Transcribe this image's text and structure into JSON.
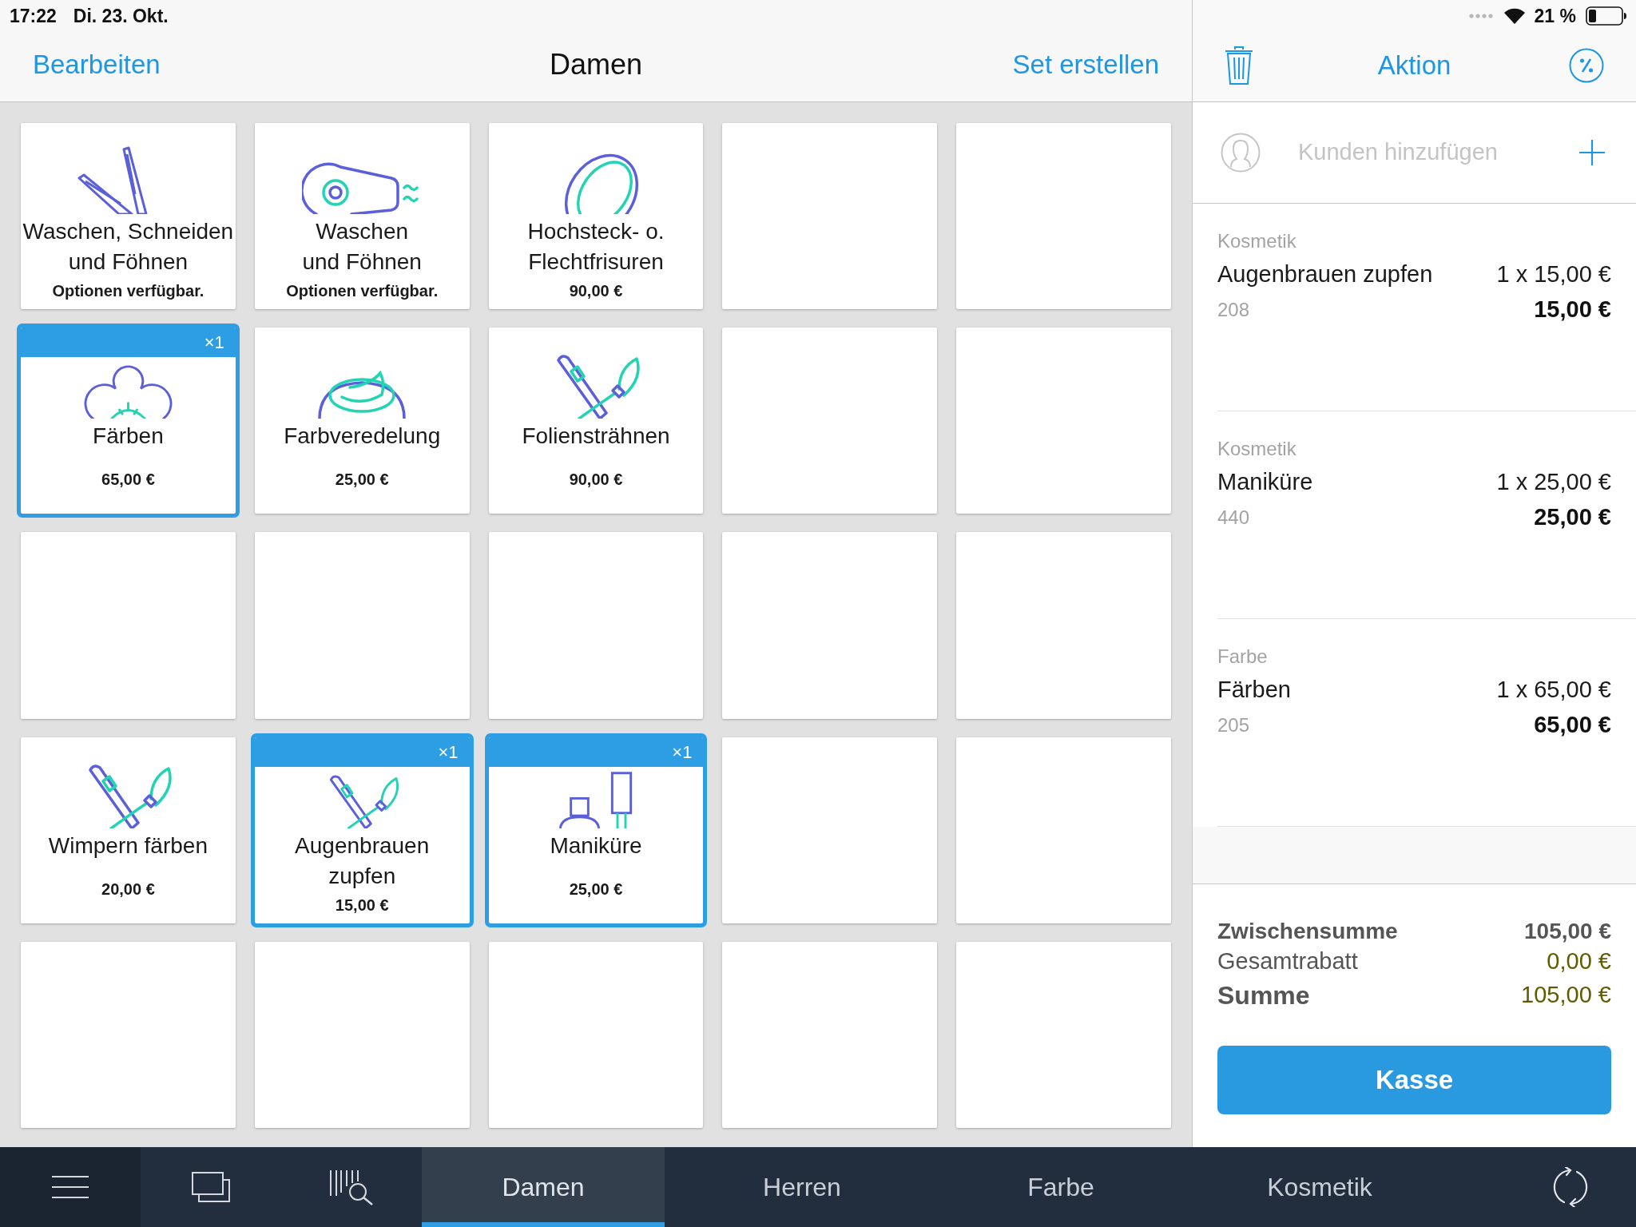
{
  "status_bar": {
    "time": "17:22",
    "date": "Di. 23. Okt.",
    "battery": "21 %"
  },
  "nav_bar": {
    "left_button": "Bearbeiten",
    "title": "Damen",
    "right_button": "Set erstellen"
  },
  "tiles": [
    {
      "kind": "service",
      "name": "Waschen, Schneiden\nund Föhnen",
      "note": "Optionen verfügbar.",
      "selected": false
    },
    {
      "kind": "service",
      "name": "Waschen\nund Föhnen",
      "note": "Optionen verfügbar.",
      "selected": false
    },
    {
      "kind": "service",
      "name": "Hochsteck- o.\nFlechtfrisuren",
      "price": "90,00 €",
      "selected": false
    },
    {
      "kind": "empty",
      "selected": false
    },
    {
      "kind": "empty",
      "selected": false
    },
    {
      "kind": "service",
      "name": "Färben",
      "price": "65,00 €",
      "selected": true,
      "badge": "×1"
    },
    {
      "kind": "service",
      "name": "Farbveredelung",
      "price": "25,00 €",
      "selected": false
    },
    {
      "kind": "service",
      "name": "Foliensträhnen",
      "price": "90,00 €",
      "selected": false
    },
    {
      "kind": "empty",
      "selected": false
    },
    {
      "kind": "empty",
      "selected": false
    },
    {
      "kind": "empty",
      "selected": false
    },
    {
      "kind": "empty",
      "selected": false
    },
    {
      "kind": "empty",
      "selected": false
    },
    {
      "kind": "empty",
      "selected": false
    },
    {
      "kind": "empty",
      "selected": false
    },
    {
      "kind": "service",
      "name": "Wimpern färben",
      "price": "20,00 €",
      "selected": false
    },
    {
      "kind": "service",
      "name": "Augenbrauen\nzupfen",
      "price": "15,00 €",
      "selected": true,
      "badge": "×1"
    },
    {
      "kind": "service",
      "name": "Maniküre",
      "price": "25,00 €",
      "selected": true,
      "badge": "×1"
    },
    {
      "kind": "empty",
      "selected": false
    },
    {
      "kind": "empty",
      "selected": false
    },
    {
      "kind": "empty",
      "selected": false
    },
    {
      "kind": "empty",
      "selected": false
    },
    {
      "kind": "empty",
      "selected": false
    },
    {
      "kind": "empty",
      "selected": false
    },
    {
      "kind": "empty",
      "selected": false
    }
  ],
  "cart": {
    "action_button": "Aktion",
    "customer": {
      "placeholder": "Kunden hinzufügen"
    },
    "items": [
      {
        "category": "Kosmetik",
        "name": "Augenbrauen zupfen",
        "quantity_price": "1 x 15,00 €",
        "number": "208",
        "total": "15,00 €"
      },
      {
        "category": "Kosmetik",
        "name": "Maniküre",
        "quantity_price": "1 x 25,00 €",
        "number": "440",
        "total": "25,00 €"
      },
      {
        "category": "Farbe",
        "name": "Färben",
        "quantity_price": "1 x 65,00 €",
        "number": "205",
        "total": "65,00 €"
      }
    ],
    "totals": [
      {
        "kind": "subtotal",
        "label": "Zwischensumme",
        "value": "105,00 €"
      },
      {
        "kind": "discount",
        "label": "Gesamtrabatt",
        "value": "0,00 €"
      },
      {
        "kind": "total",
        "label": "Summe",
        "value": "105,00 €"
      }
    ],
    "checkout_button": "Kasse"
  },
  "tab_bar": {
    "tabs": [
      {
        "label": "Damen",
        "selected": true
      },
      {
        "label": "Herren",
        "selected": false
      },
      {
        "label": "Farbe",
        "selected": false
      },
      {
        "label": "Kosmetik",
        "selected": false
      }
    ]
  }
}
